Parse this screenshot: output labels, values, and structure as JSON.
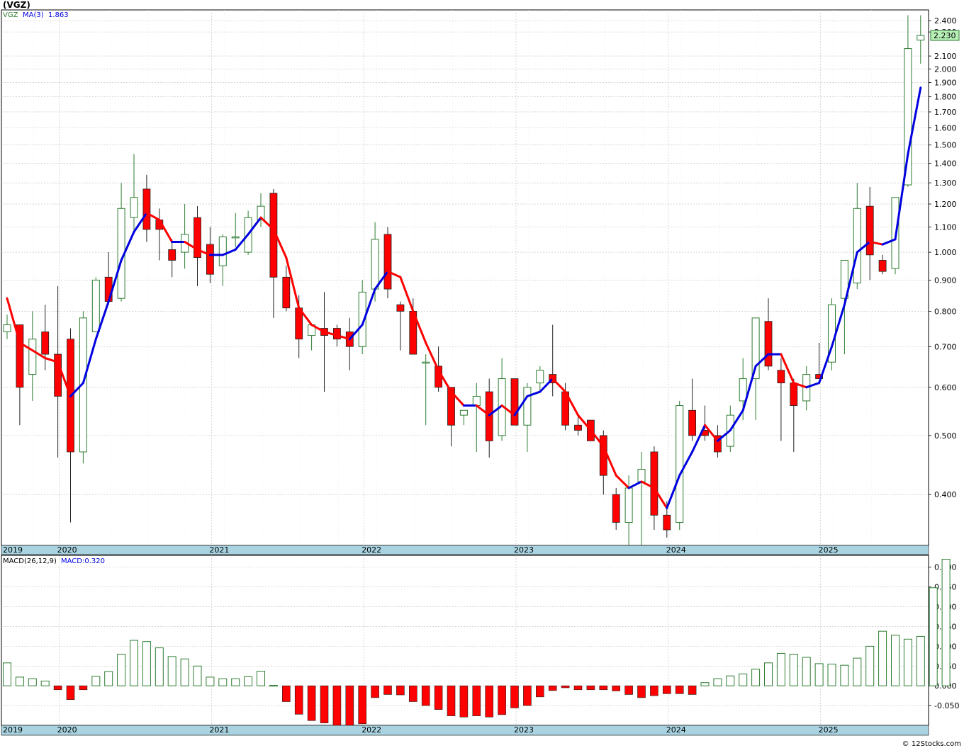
{
  "page_title": "(VGZ)",
  "credit": "© 12Stocks.com",
  "colors": {
    "up": "#2e7d32",
    "down": "#ff0000",
    "ma_up": "#0000e0",
    "ma_down": "#ff0000",
    "axis_band": "#a9d3e0",
    "last_box": "#b7f0b7"
  },
  "price_panel": {
    "legend_symbol": "VGZ",
    "legend_ma": "MA(3)",
    "legend_ma_value": "1.863",
    "last_price_label": "2.230"
  },
  "macd_panel": {
    "legend_macd": "MACD(26,12,9)",
    "legend_macd_value": "MACD:0.320"
  },
  "chart_data": [
    {
      "type": "candlestick",
      "title": "(VGZ)",
      "scale": "log",
      "ylim": [
        0.33,
        2.5
      ],
      "y_ticks": [
        "2.400",
        "2.300",
        "2.100",
        "2.000",
        "1.900",
        "1.800",
        "1.700",
        "1.600",
        "1.500",
        "1.400",
        "1.300",
        "1.200",
        "1.100",
        "1.000",
        "0.900",
        "0.800",
        "0.700",
        "0.600",
        "0.500",
        "0.400"
      ],
      "x_labels": [
        "2019",
        "2020",
        "2021",
        "2022",
        "2023",
        "2024",
        "2025"
      ],
      "grid": true,
      "ohlc": [
        [
          0.74,
          0.79,
          0.72,
          0.76
        ],
        [
          0.76,
          0.76,
          0.52,
          0.6
        ],
        [
          0.63,
          0.8,
          0.57,
          0.72
        ],
        [
          0.74,
          0.82,
          0.64,
          0.68
        ],
        [
          0.68,
          0.88,
          0.46,
          0.58
        ],
        [
          0.72,
          0.75,
          0.36,
          0.47
        ],
        [
          0.47,
          0.8,
          0.45,
          0.78
        ],
        [
          0.74,
          0.91,
          0.74,
          0.9
        ],
        [
          0.91,
          1.0,
          0.82,
          0.83
        ],
        [
          0.84,
          1.3,
          0.83,
          1.18
        ],
        [
          1.14,
          1.45,
          1.07,
          1.23
        ],
        [
          1.27,
          1.34,
          1.04,
          1.09
        ],
        [
          1.13,
          1.18,
          0.97,
          1.09
        ],
        [
          1.01,
          1.05,
          0.91,
          0.97
        ],
        [
          1.0,
          1.2,
          0.94,
          1.07
        ],
        [
          1.14,
          1.19,
          0.88,
          0.98
        ],
        [
          1.03,
          1.1,
          0.89,
          0.92
        ],
        [
          0.95,
          1.07,
          0.88,
          1.06
        ],
        [
          1.06,
          1.16,
          1.02,
          1.06
        ],
        [
          1.0,
          1.17,
          0.99,
          1.14
        ],
        [
          1.13,
          1.25,
          1.1,
          1.19
        ],
        [
          1.25,
          1.27,
          0.78,
          0.91
        ],
        [
          0.91,
          0.95,
          0.8,
          0.81
        ],
        [
          0.81,
          0.85,
          0.67,
          0.72
        ],
        [
          0.73,
          0.76,
          0.69,
          0.76
        ],
        [
          0.75,
          0.86,
          0.59,
          0.73
        ],
        [
          0.75,
          0.76,
          0.7,
          0.72
        ],
        [
          0.74,
          0.78,
          0.64,
          0.7
        ],
        [
          0.7,
          0.9,
          0.68,
          0.86
        ],
        [
          0.87,
          1.12,
          0.83,
          1.05
        ],
        [
          1.07,
          1.1,
          0.84,
          0.87
        ],
        [
          0.82,
          0.83,
          0.69,
          0.8
        ],
        [
          0.8,
          0.84,
          0.68,
          0.68
        ],
        [
          0.66,
          0.68,
          0.52,
          0.66
        ],
        [
          0.65,
          0.7,
          0.59,
          0.6
        ],
        [
          0.6,
          0.6,
          0.48,
          0.52
        ],
        [
          0.54,
          0.55,
          0.52,
          0.55
        ],
        [
          0.56,
          0.61,
          0.47,
          0.58
        ],
        [
          0.59,
          0.62,
          0.46,
          0.49
        ],
        [
          0.5,
          0.67,
          0.49,
          0.62
        ],
        [
          0.62,
          0.62,
          0.52,
          0.52
        ],
        [
          0.52,
          0.61,
          0.47,
          0.6
        ],
        [
          0.61,
          0.65,
          0.59,
          0.64
        ],
        [
          0.63,
          0.76,
          0.58,
          0.61
        ],
        [
          0.59,
          0.61,
          0.51,
          0.52
        ],
        [
          0.52,
          0.54,
          0.5,
          0.51
        ],
        [
          0.53,
          0.53,
          0.49,
          0.49
        ],
        [
          0.5,
          0.51,
          0.4,
          0.43
        ],
        [
          0.4,
          0.41,
          0.35,
          0.36
        ],
        [
          0.36,
          0.43,
          0.32,
          0.41
        ],
        [
          0.42,
          0.47,
          0.32,
          0.44
        ],
        [
          0.47,
          0.48,
          0.35,
          0.37
        ],
        [
          0.37,
          0.39,
          0.34,
          0.35
        ],
        [
          0.36,
          0.57,
          0.35,
          0.56
        ],
        [
          0.55,
          0.62,
          0.49,
          0.5
        ],
        [
          0.51,
          0.56,
          0.49,
          0.5
        ],
        [
          0.5,
          0.52,
          0.46,
          0.47
        ],
        [
          0.48,
          0.56,
          0.47,
          0.54
        ],
        [
          0.57,
          0.67,
          0.53,
          0.62
        ],
        [
          0.62,
          0.78,
          0.53,
          0.78
        ],
        [
          0.77,
          0.84,
          0.64,
          0.65
        ],
        [
          0.64,
          0.67,
          0.49,
          0.61
        ],
        [
          0.61,
          0.62,
          0.47,
          0.56
        ],
        [
          0.57,
          0.65,
          0.55,
          0.63
        ],
        [
          0.63,
          0.71,
          0.62,
          0.62
        ],
        [
          0.66,
          0.84,
          0.64,
          0.82
        ],
        [
          0.84,
          0.97,
          0.68,
          0.97
        ],
        [
          0.89,
          1.3,
          0.87,
          1.18
        ],
        [
          1.19,
          1.28,
          0.9,
          0.99
        ],
        [
          0.97,
          0.99,
          0.92,
          0.93
        ],
        [
          0.94,
          1.23,
          0.92,
          1.23
        ],
        [
          1.29,
          2.45,
          1.28,
          2.16
        ],
        [
          2.23,
          2.45,
          2.04,
          2.27
        ]
      ],
      "ma_values": [
        0.84,
        0.71,
        0.69,
        0.67,
        0.66,
        0.58,
        0.61,
        0.72,
        0.83,
        0.97,
        1.08,
        1.16,
        1.13,
        1.04,
        1.04,
        1.01,
        0.99,
        0.99,
        1.01,
        1.07,
        1.14,
        1.09,
        0.98,
        0.81,
        0.76,
        0.74,
        0.73,
        0.72,
        0.76,
        0.87,
        0.93,
        0.91,
        0.8,
        0.71,
        0.64,
        0.59,
        0.56,
        0.56,
        0.54,
        0.56,
        0.54,
        0.58,
        0.59,
        0.62,
        0.59,
        0.54,
        0.51,
        0.48,
        0.43,
        0.41,
        0.42,
        0.41,
        0.38,
        0.43,
        0.47,
        0.52,
        0.49,
        0.51,
        0.55,
        0.65,
        0.68,
        0.68,
        0.61,
        0.6,
        0.61,
        0.7,
        0.82,
        1.0,
        1.04,
        1.03,
        1.05,
        1.45,
        1.863
      ]
    },
    {
      "type": "bar",
      "title": "MACD(26,12,9)",
      "ylim": [
        -0.1,
        0.33
      ],
      "y_ticks": [
        "0.300",
        "0.250",
        "0.200",
        "0.150",
        "0.100",
        "0.050",
        "0.000",
        "-0.050"
      ],
      "x_labels": [
        "2019",
        "2020",
        "2021",
        "2022",
        "2023",
        "2024",
        "2025"
      ],
      "values": [
        0.058,
        0.022,
        0.018,
        0.012,
        -0.01,
        -0.035,
        -0.01,
        0.024,
        0.036,
        0.08,
        0.115,
        0.112,
        0.096,
        0.074,
        0.068,
        0.05,
        0.022,
        0.018,
        0.018,
        0.023,
        0.037,
        0.001,
        -0.04,
        -0.072,
        -0.088,
        -0.094,
        -0.102,
        -0.104,
        -0.096,
        -0.03,
        -0.022,
        -0.023,
        -0.04,
        -0.05,
        -0.06,
        -0.076,
        -0.079,
        -0.076,
        -0.079,
        -0.073,
        -0.056,
        -0.05,
        -0.028,
        -0.012,
        -0.005,
        -0.01,
        -0.01,
        -0.01,
        -0.013,
        -0.022,
        -0.03,
        -0.025,
        -0.02,
        -0.02,
        -0.022,
        0.008,
        0.018,
        0.025,
        0.03,
        0.042,
        0.058,
        0.082,
        0.08,
        0.072,
        0.056,
        0.055,
        0.052,
        0.07,
        0.1,
        0.138,
        0.128,
        0.118,
        0.125,
        0.248,
        0.32
      ]
    }
  ]
}
